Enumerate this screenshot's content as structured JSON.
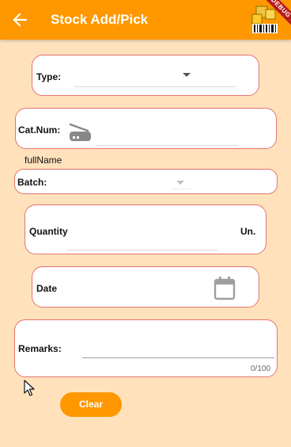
{
  "appbar": {
    "title": "Stock Add/Pick",
    "back_icon": "arrow-back-icon",
    "logo_icon": "barcode-app-logo",
    "debug_badge": "DEBUG",
    "color": "#FF9800"
  },
  "form": {
    "type": {
      "label": "Type:",
      "value": ""
    },
    "cat_num": {
      "label": "Cat.Num:",
      "value": "",
      "icon": "barcode-scanner-icon"
    },
    "full_name": "fullName",
    "batch": {
      "label": "Batch:",
      "value": ""
    },
    "quantity": {
      "label": "Quantity",
      "unit": "Un.",
      "value": ""
    },
    "date": {
      "label": "Date",
      "icon": "calendar-icon",
      "value": ""
    },
    "remarks": {
      "label": "Remarks:",
      "value": "",
      "counter": "0/100"
    }
  },
  "actions": {
    "clear_label": "Clear"
  },
  "colors": {
    "background": "#FFE2BB",
    "card_border": "#E57373",
    "accent": "#FF9800"
  }
}
